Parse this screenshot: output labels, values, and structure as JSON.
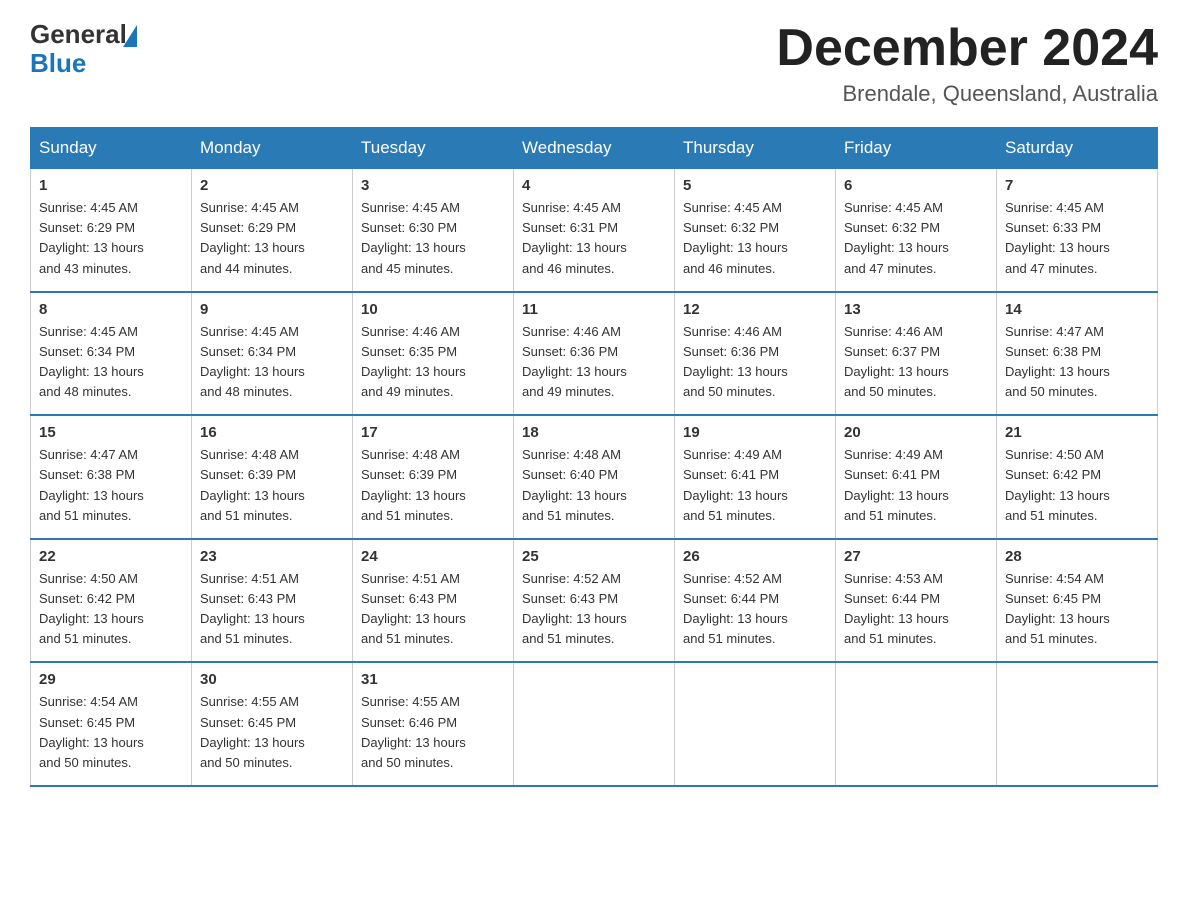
{
  "logo": {
    "general": "General",
    "blue": "Blue"
  },
  "title": "December 2024",
  "location": "Brendale, Queensland, Australia",
  "days_of_week": [
    "Sunday",
    "Monday",
    "Tuesday",
    "Wednesday",
    "Thursday",
    "Friday",
    "Saturday"
  ],
  "weeks": [
    [
      {
        "day": "1",
        "sunrise": "4:45 AM",
        "sunset": "6:29 PM",
        "daylight": "13 hours and 43 minutes."
      },
      {
        "day": "2",
        "sunrise": "4:45 AM",
        "sunset": "6:29 PM",
        "daylight": "13 hours and 44 minutes."
      },
      {
        "day": "3",
        "sunrise": "4:45 AM",
        "sunset": "6:30 PM",
        "daylight": "13 hours and 45 minutes."
      },
      {
        "day": "4",
        "sunrise": "4:45 AM",
        "sunset": "6:31 PM",
        "daylight": "13 hours and 46 minutes."
      },
      {
        "day": "5",
        "sunrise": "4:45 AM",
        "sunset": "6:32 PM",
        "daylight": "13 hours and 46 minutes."
      },
      {
        "day": "6",
        "sunrise": "4:45 AM",
        "sunset": "6:32 PM",
        "daylight": "13 hours and 47 minutes."
      },
      {
        "day": "7",
        "sunrise": "4:45 AM",
        "sunset": "6:33 PM",
        "daylight": "13 hours and 47 minutes."
      }
    ],
    [
      {
        "day": "8",
        "sunrise": "4:45 AM",
        "sunset": "6:34 PM",
        "daylight": "13 hours and 48 minutes."
      },
      {
        "day": "9",
        "sunrise": "4:45 AM",
        "sunset": "6:34 PM",
        "daylight": "13 hours and 48 minutes."
      },
      {
        "day": "10",
        "sunrise": "4:46 AM",
        "sunset": "6:35 PM",
        "daylight": "13 hours and 49 minutes."
      },
      {
        "day": "11",
        "sunrise": "4:46 AM",
        "sunset": "6:36 PM",
        "daylight": "13 hours and 49 minutes."
      },
      {
        "day": "12",
        "sunrise": "4:46 AM",
        "sunset": "6:36 PM",
        "daylight": "13 hours and 50 minutes."
      },
      {
        "day": "13",
        "sunrise": "4:46 AM",
        "sunset": "6:37 PM",
        "daylight": "13 hours and 50 minutes."
      },
      {
        "day": "14",
        "sunrise": "4:47 AM",
        "sunset": "6:38 PM",
        "daylight": "13 hours and 50 minutes."
      }
    ],
    [
      {
        "day": "15",
        "sunrise": "4:47 AM",
        "sunset": "6:38 PM",
        "daylight": "13 hours and 51 minutes."
      },
      {
        "day": "16",
        "sunrise": "4:48 AM",
        "sunset": "6:39 PM",
        "daylight": "13 hours and 51 minutes."
      },
      {
        "day": "17",
        "sunrise": "4:48 AM",
        "sunset": "6:39 PM",
        "daylight": "13 hours and 51 minutes."
      },
      {
        "day": "18",
        "sunrise": "4:48 AM",
        "sunset": "6:40 PM",
        "daylight": "13 hours and 51 minutes."
      },
      {
        "day": "19",
        "sunrise": "4:49 AM",
        "sunset": "6:41 PM",
        "daylight": "13 hours and 51 minutes."
      },
      {
        "day": "20",
        "sunrise": "4:49 AM",
        "sunset": "6:41 PM",
        "daylight": "13 hours and 51 minutes."
      },
      {
        "day": "21",
        "sunrise": "4:50 AM",
        "sunset": "6:42 PM",
        "daylight": "13 hours and 51 minutes."
      }
    ],
    [
      {
        "day": "22",
        "sunrise": "4:50 AM",
        "sunset": "6:42 PM",
        "daylight": "13 hours and 51 minutes."
      },
      {
        "day": "23",
        "sunrise": "4:51 AM",
        "sunset": "6:43 PM",
        "daylight": "13 hours and 51 minutes."
      },
      {
        "day": "24",
        "sunrise": "4:51 AM",
        "sunset": "6:43 PM",
        "daylight": "13 hours and 51 minutes."
      },
      {
        "day": "25",
        "sunrise": "4:52 AM",
        "sunset": "6:43 PM",
        "daylight": "13 hours and 51 minutes."
      },
      {
        "day": "26",
        "sunrise": "4:52 AM",
        "sunset": "6:44 PM",
        "daylight": "13 hours and 51 minutes."
      },
      {
        "day": "27",
        "sunrise": "4:53 AM",
        "sunset": "6:44 PM",
        "daylight": "13 hours and 51 minutes."
      },
      {
        "day": "28",
        "sunrise": "4:54 AM",
        "sunset": "6:45 PM",
        "daylight": "13 hours and 51 minutes."
      }
    ],
    [
      {
        "day": "29",
        "sunrise": "4:54 AM",
        "sunset": "6:45 PM",
        "daylight": "13 hours and 50 minutes."
      },
      {
        "day": "30",
        "sunrise": "4:55 AM",
        "sunset": "6:45 PM",
        "daylight": "13 hours and 50 minutes."
      },
      {
        "day": "31",
        "sunrise": "4:55 AM",
        "sunset": "6:46 PM",
        "daylight": "13 hours and 50 minutes."
      },
      null,
      null,
      null,
      null
    ]
  ],
  "labels": {
    "sunrise": "Sunrise:",
    "sunset": "Sunset:",
    "daylight": "Daylight:"
  }
}
